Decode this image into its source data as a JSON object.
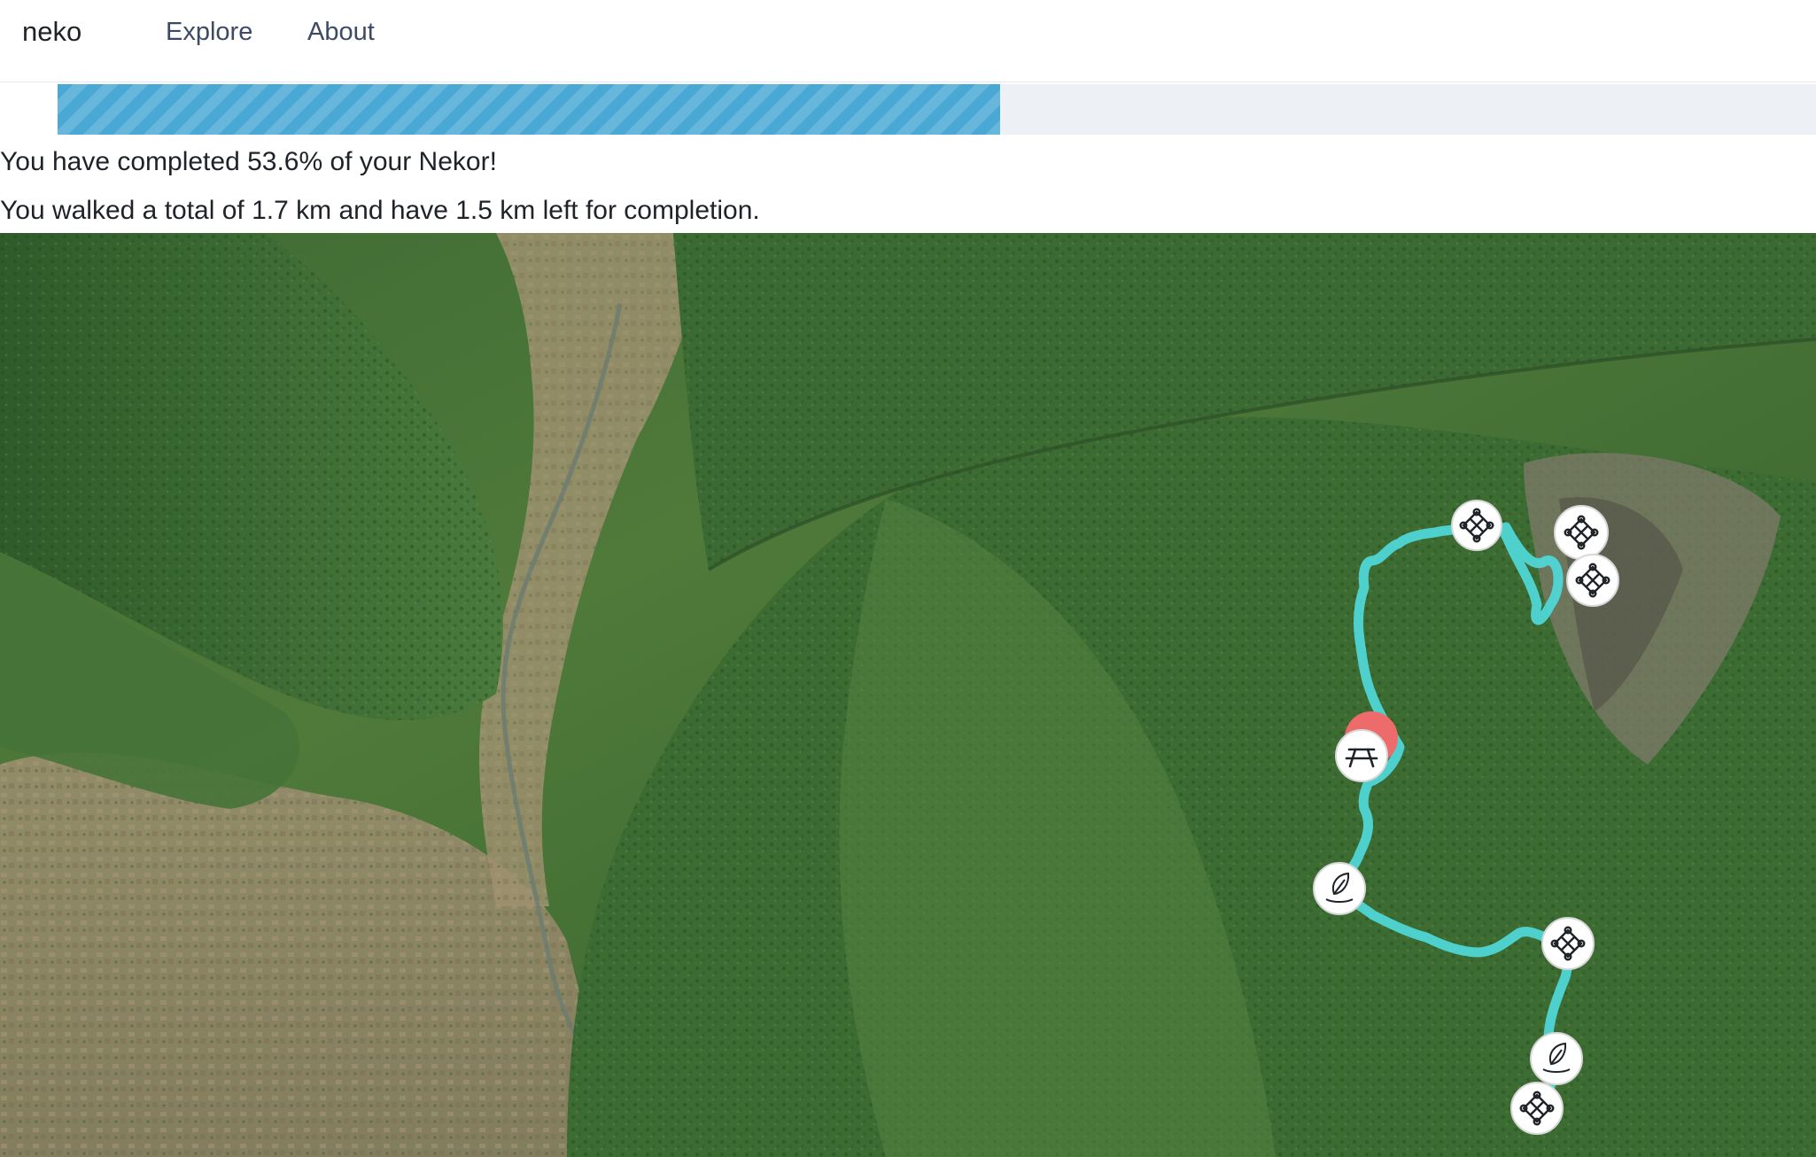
{
  "navbar": {
    "brand": "neko",
    "links": [
      {
        "label": "Explore"
      },
      {
        "label": "About"
      }
    ]
  },
  "progress": {
    "percent": 53.6,
    "fill_color": "#4aa8d4",
    "track_color": "#edf0f4"
  },
  "status": {
    "completed_text": "You have completed 53.6% of your Nekor!",
    "distance_text": "You walked a total of 1.7 km and have 1.5 km left for completion."
  },
  "map": {
    "route_color": "#4fd6d6",
    "current_position_color": "#ee6b6b",
    "markers": [
      {
        "icon": "endless-knot-icon"
      },
      {
        "icon": "endless-knot-icon"
      },
      {
        "icon": "endless-knot-icon"
      },
      {
        "icon": "picnic-table-icon"
      },
      {
        "icon": "leaf-water-icon"
      },
      {
        "icon": "endless-knot-icon"
      },
      {
        "icon": "leaf-water-icon"
      },
      {
        "icon": "endless-knot-icon"
      }
    ]
  }
}
